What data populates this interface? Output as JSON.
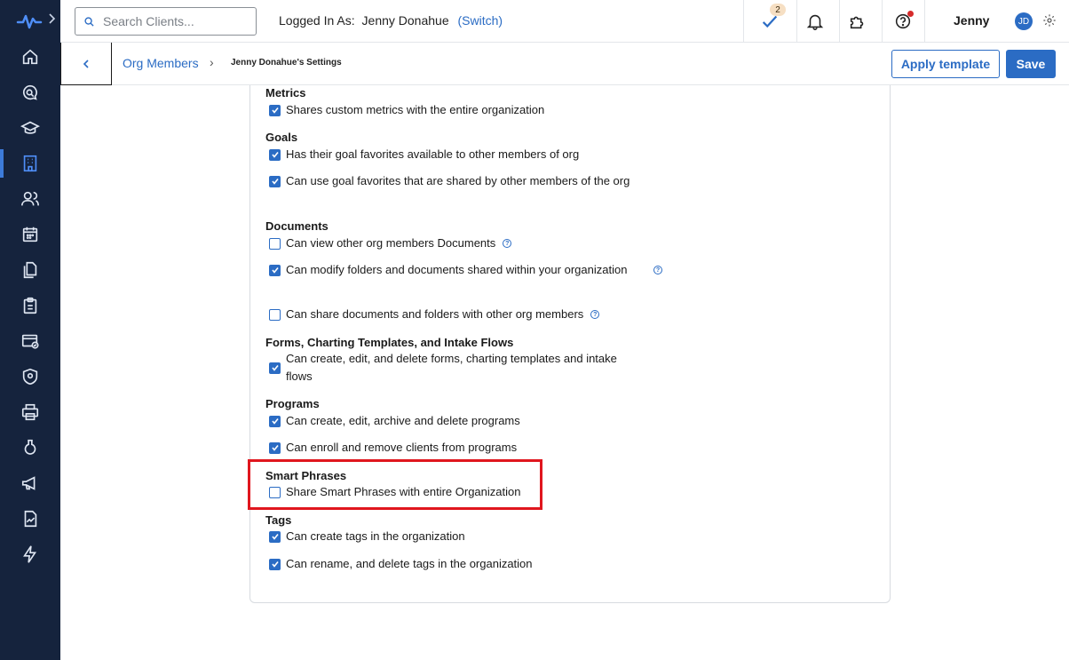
{
  "topbar": {
    "search_placeholder": "Search Clients...",
    "logged_in_label": "Logged In As:",
    "logged_in_user": "Jenny Donahue",
    "switch_label": "(Switch)",
    "tasks_count": "2",
    "user_name": "Jenny",
    "avatar_initials": "JD"
  },
  "subheader": {
    "breadcrumb_parent": "Org Members",
    "breadcrumb_separator": "›",
    "breadcrumb_current": "Jenny Donahue's Settings",
    "apply_template_label": "Apply template",
    "save_label": "Save"
  },
  "sidebar": {
    "items": [
      {
        "icon": "home-icon"
      },
      {
        "icon": "search-chat-icon"
      },
      {
        "icon": "graduation-cap-icon"
      },
      {
        "icon": "building-icon",
        "active": true
      },
      {
        "icon": "users-icon"
      },
      {
        "icon": "calendar-icon"
      },
      {
        "icon": "documents-icon"
      },
      {
        "icon": "clipboard-icon"
      },
      {
        "icon": "billing-icon"
      },
      {
        "icon": "shield-icon"
      },
      {
        "icon": "printer-icon"
      },
      {
        "icon": "flask-icon"
      },
      {
        "icon": "megaphone-icon"
      },
      {
        "icon": "report-icon"
      },
      {
        "icon": "lightning-icon"
      }
    ]
  },
  "sections": {
    "metrics": {
      "title": "Metrics",
      "options": [
        {
          "label": "Shares custom metrics with the entire organization",
          "checked": true
        }
      ]
    },
    "goals": {
      "title": "Goals",
      "options": [
        {
          "label": "Has their goal favorites available to other members of org",
          "checked": true
        },
        {
          "label": "Can use goal favorites that are shared by other members of the org",
          "checked": true
        }
      ]
    },
    "documents": {
      "title": "Documents",
      "options": [
        {
          "label": "Can view other org members Documents",
          "checked": false,
          "help": true
        },
        {
          "label": "Can modify folders and documents shared within your organization",
          "checked": true,
          "help": true
        },
        {
          "label": "Can share documents and folders with other org members",
          "checked": false,
          "help": true
        }
      ]
    },
    "forms": {
      "title": "Forms, Charting Templates, and Intake Flows",
      "options": [
        {
          "label": "Can create, edit, and delete forms, charting templates and intake flows",
          "checked": true
        }
      ]
    },
    "programs": {
      "title": "Programs",
      "options": [
        {
          "label": "Can create, edit, archive and delete programs",
          "checked": true
        },
        {
          "label": "Can enroll and remove clients from programs",
          "checked": true
        }
      ]
    },
    "smart_phrases": {
      "title": "Smart Phrases",
      "options": [
        {
          "label": "Share Smart Phrases with entire Organization",
          "checked": false
        }
      ]
    },
    "tags": {
      "title": "Tags",
      "options": [
        {
          "label": "Can create tags in the organization",
          "checked": true
        },
        {
          "label": "Can rename, and delete tags in the organization",
          "checked": true
        }
      ]
    }
  },
  "colors": {
    "accent": "#2b6cc4",
    "sidebar_bg": "#15233d",
    "highlight": "#e0161e"
  }
}
